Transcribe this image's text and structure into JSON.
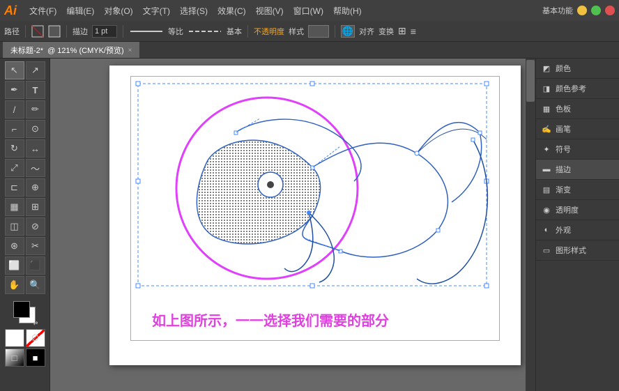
{
  "app": {
    "logo": "Ai",
    "workspace_label": "基本功能",
    "window_buttons": [
      "minimize",
      "maximize",
      "close"
    ]
  },
  "menu": {
    "items": [
      "文件(F)",
      "编辑(E)",
      "对象(O)",
      "文字(T)",
      "选择(S)",
      "效果(C)",
      "视图(V)",
      "窗口(W)",
      "帮助(H)"
    ]
  },
  "toolbar": {
    "path_label": "路径",
    "stroke_label": "描边",
    "size_value": "1 pt",
    "scale_label": "等比",
    "mode_label": "基本",
    "opacity_label": "不透明度",
    "style_label": "样式",
    "align_label": "对齐",
    "transform_label": "变换"
  },
  "tab": {
    "title": "未标题-2*",
    "info": "@ 121% (CMYK/预览)",
    "close": "×"
  },
  "tools": [
    {
      "name": "selection",
      "icon": "↖",
      "title": "选择工具"
    },
    {
      "name": "direct-selection",
      "icon": "↗",
      "title": "直接选择"
    },
    {
      "name": "pen",
      "icon": "✒",
      "title": "钢笔"
    },
    {
      "name": "text",
      "icon": "T",
      "title": "文字"
    },
    {
      "name": "shape",
      "icon": "○",
      "title": "形状"
    },
    {
      "name": "pencil",
      "icon": "✏",
      "title": "铅笔"
    },
    {
      "name": "brush",
      "icon": "⌐",
      "title": "画笔"
    },
    {
      "name": "rotate",
      "icon": "↻",
      "title": "旋转"
    },
    {
      "name": "scale",
      "icon": "⤢",
      "title": "缩放"
    },
    {
      "name": "warp",
      "icon": "〜",
      "title": "变形"
    },
    {
      "name": "gradient",
      "icon": "▦",
      "title": "渐变"
    },
    {
      "name": "eyedropper",
      "icon": "⊙",
      "title": "吸管"
    },
    {
      "name": "blend",
      "icon": "⊛",
      "title": "混合"
    },
    {
      "name": "scissors",
      "icon": "✂",
      "title": "剪刀"
    },
    {
      "name": "artboard",
      "icon": "⬜",
      "title": "画板"
    },
    {
      "name": "hand",
      "icon": "✋",
      "title": "手形"
    },
    {
      "name": "zoom",
      "icon": "🔍",
      "title": "缩放"
    }
  ],
  "right_panel": {
    "items": [
      {
        "icon": "◩",
        "label": "颜色"
      },
      {
        "icon": "◨",
        "label": "颜色参考"
      },
      {
        "icon": "▦",
        "label": "色板"
      },
      {
        "icon": "✍",
        "label": "画笔"
      },
      {
        "icon": "✦",
        "label": "符号"
      },
      {
        "icon": "▬",
        "label": "描边"
      },
      {
        "icon": "▤",
        "label": "渐变"
      },
      {
        "icon": "◉",
        "label": "透明度"
      },
      {
        "icon": "◐",
        "label": "外观"
      },
      {
        "icon": "▭",
        "label": "图形样式"
      }
    ]
  },
  "caption": {
    "text": "如上图所示，一一选择我们需要的部分"
  },
  "colors": {
    "accent_pink": "#e040fb",
    "path_blue": "#2050c0",
    "selection_blue": "#4080ff",
    "dot_fill": "#808080"
  }
}
